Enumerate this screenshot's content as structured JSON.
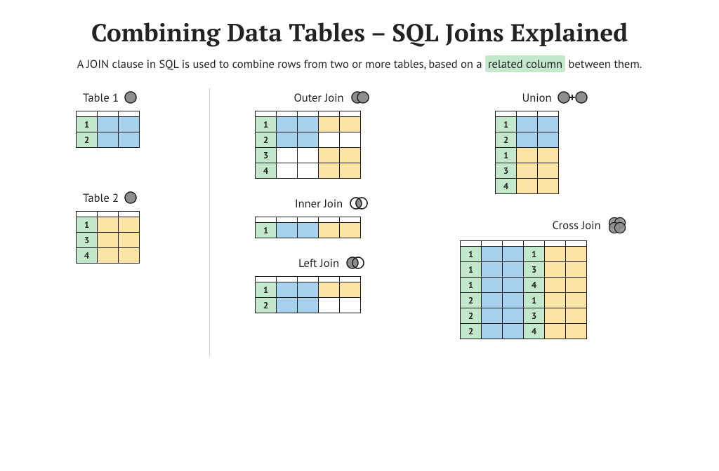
{
  "title": "Combining Data Tables – SQL Joins Explained",
  "subtitle_pre": "A JOIN clause in SQL is used to combine rows from two or more tables, based on a ",
  "subtitle_hl": "related column",
  "subtitle_post": " between them.",
  "colors": {
    "key": "#c4e8cc",
    "table1": "#a8d1ee",
    "table2": "#fce3a6",
    "icon_fill": "#8e8e8e",
    "icon_stroke": "#1b1b1b"
  },
  "labels": {
    "table1": "Table 1",
    "table2": "Table 2",
    "outer": "Outer Join",
    "inner": "Inner Join",
    "left": "Left Join",
    "union": "Union",
    "cross": "Cross Join"
  },
  "tables": {
    "table1": {
      "cols": 3,
      "rows": [
        {
          "key": "1",
          "cells": [
            "b",
            "b"
          ]
        },
        {
          "key": "2",
          "cells": [
            "b",
            "b"
          ]
        }
      ]
    },
    "table2": {
      "cols": 3,
      "rows": [
        {
          "key": "1",
          "cells": [
            "y",
            "y"
          ]
        },
        {
          "key": "3",
          "cells": [
            "y",
            "y"
          ]
        },
        {
          "key": "4",
          "cells": [
            "y",
            "y"
          ]
        }
      ]
    },
    "outer": {
      "cols": 5,
      "rows": [
        {
          "key": "1",
          "cells": [
            "b",
            "b",
            "y",
            "y"
          ]
        },
        {
          "key": "2",
          "cells": [
            "b",
            "b",
            "w",
            "w"
          ]
        },
        {
          "key": "3",
          "cells": [
            "w",
            "w",
            "y",
            "y"
          ]
        },
        {
          "key": "4",
          "cells": [
            "w",
            "w",
            "y",
            "y"
          ]
        }
      ]
    },
    "inner": {
      "cols": 5,
      "rows": [
        {
          "key": "1",
          "cells": [
            "b",
            "b",
            "y",
            "y"
          ]
        }
      ]
    },
    "left": {
      "cols": 5,
      "rows": [
        {
          "key": "1",
          "cells": [
            "b",
            "b",
            "y",
            "y"
          ]
        },
        {
          "key": "2",
          "cells": [
            "b",
            "b",
            "w",
            "w"
          ]
        }
      ]
    },
    "union": {
      "cols": 3,
      "rows": [
        {
          "key": "1",
          "cells": [
            "b",
            "b"
          ]
        },
        {
          "key": "2",
          "cells": [
            "b",
            "b"
          ]
        },
        {
          "key": "1",
          "cells": [
            "y",
            "y"
          ]
        },
        {
          "key": "3",
          "cells": [
            "y",
            "y"
          ]
        },
        {
          "key": "4",
          "cells": [
            "y",
            "y"
          ]
        }
      ]
    },
    "cross": {
      "cols": 6,
      "rows": [
        {
          "key1": "1",
          "cells1": [
            "b",
            "b"
          ],
          "key2": "1",
          "cells2": [
            "y",
            "y"
          ]
        },
        {
          "key1": "1",
          "cells1": [
            "b",
            "b"
          ],
          "key2": "3",
          "cells2": [
            "y",
            "y"
          ]
        },
        {
          "key1": "1",
          "cells1": [
            "b",
            "b"
          ],
          "key2": "4",
          "cells2": [
            "y",
            "y"
          ]
        },
        {
          "key1": "2",
          "cells1": [
            "b",
            "b"
          ],
          "key2": "1",
          "cells2": [
            "y",
            "y"
          ]
        },
        {
          "key1": "2",
          "cells1": [
            "b",
            "b"
          ],
          "key2": "3",
          "cells2": [
            "y",
            "y"
          ]
        },
        {
          "key1": "2",
          "cells1": [
            "b",
            "b"
          ],
          "key2": "4",
          "cells2": [
            "y",
            "y"
          ]
        }
      ]
    }
  }
}
